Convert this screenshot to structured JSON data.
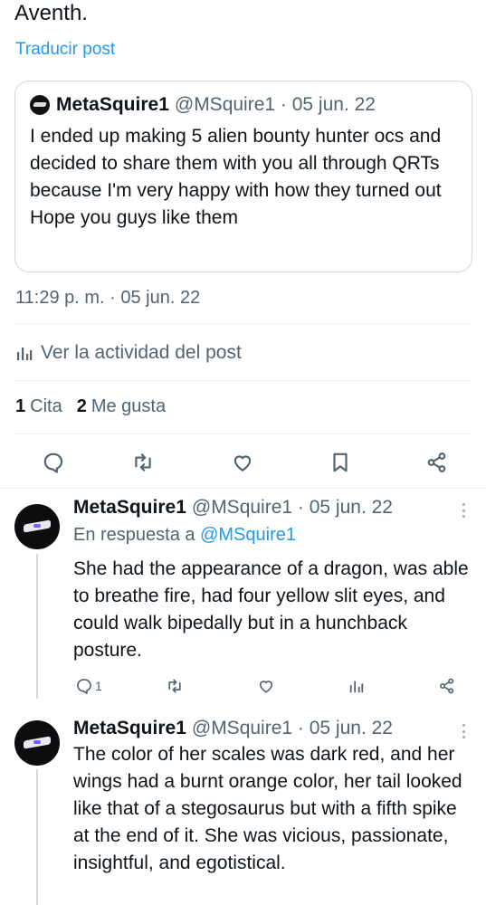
{
  "post": {
    "text_tail": "Aventh.",
    "translate_label": "Traducir post",
    "timestamp": "11:29 p. m. · 05 jun. 22",
    "activity_label": "Ver la actividad del post",
    "stats": [
      {
        "count": "1",
        "label": "Cita"
      },
      {
        "count": "2",
        "label": "Me gusta"
      }
    ]
  },
  "quote": {
    "name": "MetaSquire1",
    "handle_date": "@MSquire1 · 05 jun. 22",
    "body": "I ended up making 5 alien bounty hunter ocs and decided to share them with you all through QRTs because I'm very happy with how they turned out\nHope you guys like them"
  },
  "actions": {
    "icons": [
      "reply-icon",
      "retweet-icon",
      "like-icon",
      "bookmark-icon",
      "share-icon"
    ]
  },
  "replies": [
    {
      "name": "MetaSquire1",
      "handle_date": "@MSquire1 · 05 jun. 22",
      "in_reply_prefix": "En respuesta a",
      "in_reply_handle": "@MSquire1",
      "body": "She had the appearance of a dragon, was able to breathe fire, had four yellow slit eyes, and could walk bipedally but in a hunchback posture.",
      "reply_count": "1"
    },
    {
      "name": "MetaSquire1",
      "handle_date": "@MSquire1 · 05 jun. 22",
      "body": "The color of her scales was dark red, and her wings had a burnt orange color, her tail looked like that of a stegosaurus but with a fifth spike at the end of it. She was vicious, passionate, insightful, and egotistical."
    }
  ],
  "colors": {
    "link": "#1d9bf0",
    "text": "#0f1419",
    "secondary": "#536471",
    "border": "#cfd9de"
  }
}
